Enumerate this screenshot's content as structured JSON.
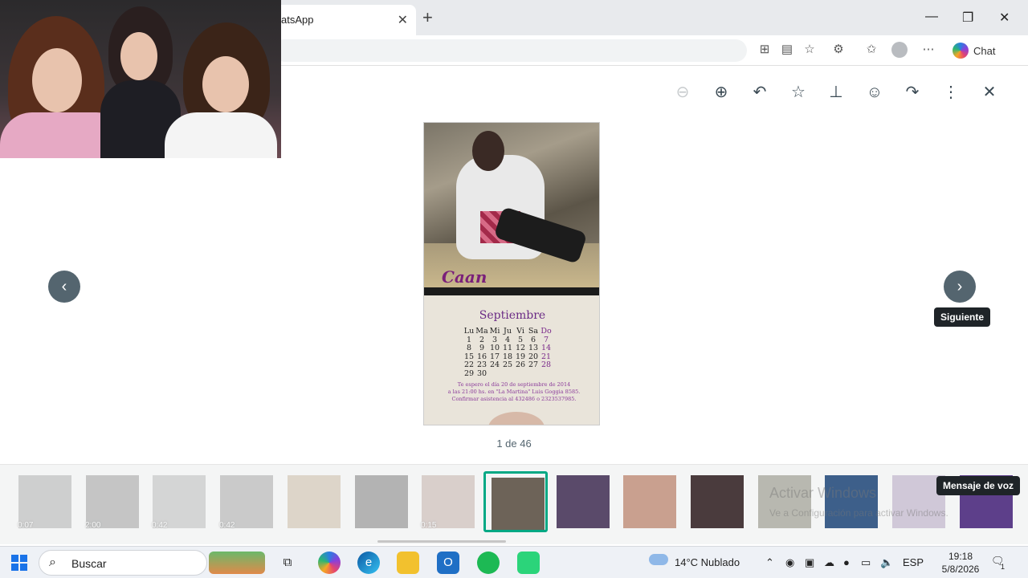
{
  "browser": {
    "tab_title": "atsApp",
    "tab_close": "✕",
    "new_tab": "+",
    "window_controls": {
      "minimize": "—",
      "restore": "❐",
      "close": "✕"
    },
    "toolbar_icons": [
      "apps-icon",
      "reading-view-icon",
      "favorite-star-icon",
      "extensions-icon",
      "favorites-icon",
      "profile-avatar-icon",
      "more-menu-icon"
    ],
    "chat_label": "Chat"
  },
  "viewer": {
    "tools": [
      "zoom-out-icon",
      "zoom-in-icon",
      "reply-icon",
      "star-icon",
      "pin-icon",
      "emoji-icon",
      "forward-icon",
      "more-options-icon",
      "close-icon"
    ],
    "counter": "1 de 46",
    "prev_glyph": "‹",
    "next_glyph": "›",
    "next_tooltip": "Siguiente",
    "voice_tooltip": "Mensaje de voz"
  },
  "image": {
    "name_script": "Caan",
    "calendar": {
      "month": "Septiembre",
      "headers": [
        "Lu",
        "Ma",
        "Mi",
        "Ju",
        "Vi",
        "Sa",
        "Do"
      ],
      "rows": [
        [
          "1",
          "2",
          "3",
          "4",
          "5",
          "6",
          "7"
        ],
        [
          "8",
          "9",
          "10",
          "11",
          "12",
          "13",
          "14"
        ],
        [
          "15",
          "16",
          "17",
          "18",
          "19",
          "20",
          "21"
        ],
        [
          "22",
          "23",
          "24",
          "25",
          "26",
          "27",
          "28"
        ],
        [
          "29",
          "30",
          "",
          "",
          "",
          "",
          ""
        ]
      ],
      "note_line1": "Te espero el día 20 de septiembre de 2014",
      "note_line2": "a las 21:00 hs. en \"La Martina\" Luis Goggia 8585.",
      "note_line3": "Confirmar asistencia al 432486 o 2323537985."
    }
  },
  "thumbnails": [
    {
      "duration": "0:07",
      "faded": true,
      "active": false,
      "color": "#8a8a8a"
    },
    {
      "duration": "2:00",
      "faded": true,
      "active": false,
      "color": "#6f6f6f"
    },
    {
      "duration": "0:42",
      "faded": true,
      "active": false,
      "color": "#9a9a9a"
    },
    {
      "duration": "0:42",
      "faded": true,
      "active": false,
      "color": "#7d7d7d"
    },
    {
      "duration": "",
      "faded": true,
      "active": false,
      "color": "#b59a7a"
    },
    {
      "duration": "",
      "faded": true,
      "active": false,
      "color": "#3c3c3c"
    },
    {
      "duration": "0:15",
      "faded": true,
      "active": false,
      "color": "#a88a80"
    },
    {
      "duration": "",
      "faded": false,
      "active": true,
      "color": "#6d6358"
    },
    {
      "duration": "",
      "faded": false,
      "active": false,
      "color": "#5a4a6a"
    },
    {
      "duration": "",
      "faded": false,
      "active": false,
      "color": "#c9a08f"
    },
    {
      "duration": "",
      "faded": false,
      "active": false,
      "color": "#4a3b3d"
    },
    {
      "duration": "",
      "faded": false,
      "active": false,
      "color": "#b8b8b0"
    },
    {
      "duration": "",
      "faded": false,
      "active": false,
      "color": "#3d5f8a"
    },
    {
      "duration": "",
      "faded": false,
      "active": false,
      "color": "#d0c8d8"
    },
    {
      "duration": "",
      "faded": false,
      "active": false,
      "color": "#5d3f8a"
    }
  ],
  "watermark": {
    "line1": "Activar Windows",
    "line2": "Ve a Configuración para activar Windows."
  },
  "taskbar": {
    "search_label": "Buscar",
    "weather": "14°C  Nublado",
    "language": "ESP",
    "time": "19:18",
    "date": "5/8/2026",
    "notification_count": "1"
  }
}
